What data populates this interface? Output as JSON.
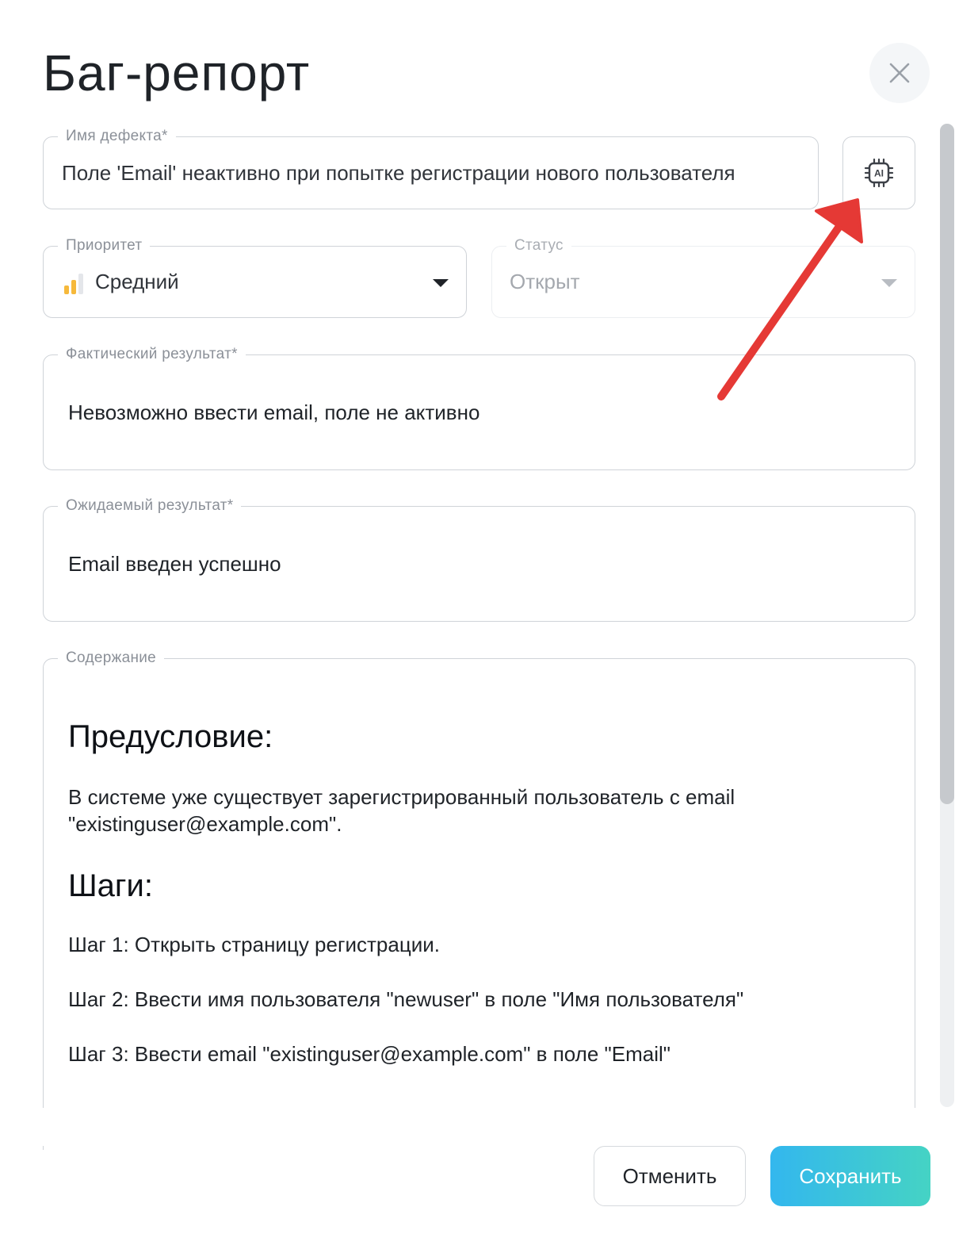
{
  "dialog": {
    "title": "Баг-репорт"
  },
  "fields": {
    "defect_name": {
      "label": "Имя дефекта*",
      "value": "Поле 'Email' неактивно при попытке регистрации нового пользователя"
    },
    "priority": {
      "label": "Приоритет",
      "value": "Средний",
      "icon": "priority-medium-bars-icon",
      "color": "#f6b93b"
    },
    "status": {
      "label": "Статус",
      "value": "Открыт"
    },
    "actual_result": {
      "label": "Фактический результат*",
      "value": "Невозможно ввести email, поле не активно"
    },
    "expected_result": {
      "label": "Ожидаемый результат*",
      "value": "Email введен успешно"
    },
    "content": {
      "label": "Содержание",
      "precondition_heading": "Предусловие:",
      "precondition_line1": "В системе уже существует зарегистрированный пользователь с email",
      "precondition_line2": "\"existinguser@example.com\".",
      "steps_heading": "Шаги:",
      "steps": [
        "Шаг 1: Открыть страницу регистрации.",
        "Шаг 2: Ввести имя пользователя \"newuser\" в поле \"Имя пользователя\"",
        "Шаг 3: Ввести email \"existinguser@example.com\" в поле \"Email\""
      ]
    }
  },
  "ai_button": {
    "label": "AI",
    "icon": "ai-chip-icon"
  },
  "actions": {
    "cancel_label": "Отменить",
    "save_label": "Сохранить"
  },
  "colors": {
    "save_gradient_start": "#33b7ee",
    "save_gradient_end": "#45d3c4",
    "annotation_arrow": "#e53935"
  }
}
